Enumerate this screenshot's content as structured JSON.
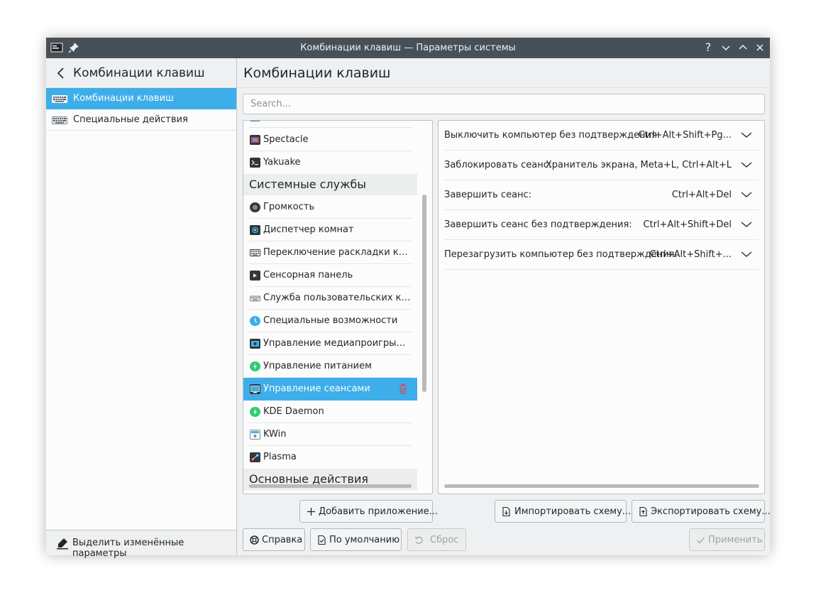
{
  "window": {
    "title": "Комбинации клавиш — Параметры системы"
  },
  "sidebar": {
    "title": "Комбинации клавиш",
    "items": [
      {
        "label": "Комбинации клавиш",
        "active": true
      },
      {
        "label": "Специальные действия",
        "active": false
      }
    ],
    "footer_label": "Выделить изменённые параметры"
  },
  "main": {
    "title": "Комбинации клавиш",
    "search": {
      "placeholder": "Search...",
      "value": ""
    }
  },
  "apps": {
    "top_items": [
      "Spectacle",
      "Yakuake"
    ],
    "section_system": "Системные службы",
    "system_items": [
      "Громкость",
      "Диспетчер комнат",
      "Переключение раскладки клавиатуры",
      "Сенсорная панель",
      "Служба пользовательских комбинаций клавиш",
      "Специальные возможности",
      "Управление медиапроигрывателем",
      "Управление питанием",
      "Управление сеансами",
      "KDE Daemon",
      "KWin",
      "Plasma"
    ],
    "selected": "Управление сеансами",
    "section_common": "Основные действия"
  },
  "shortcuts": [
    {
      "name": "Выключить компьютер без подтверждения:",
      "keys": "Ctrl+Alt+Shift+Pg..."
    },
    {
      "name": "Заблокировать сеанс:",
      "keys": "Хранитель экрана, Meta+L, Ctrl+Alt+L"
    },
    {
      "name": "Завершить сеанс:",
      "keys": "Ctrl+Alt+Del"
    },
    {
      "name": "Завершить сеанс без подтверждения:",
      "keys": "Ctrl+Alt+Shift+Del"
    },
    {
      "name": "Перезагрузить компьютер без подтверждения:",
      "keys": "Ctrl+Alt+Shift+..."
    }
  ],
  "buttons": {
    "add_app": "Добавить приложение...",
    "import": "Импортировать схему...",
    "export": "Экспортировать схему...",
    "help": "Справка",
    "defaults": "По умолчанию",
    "reset": "Сброс",
    "apply": "Применить"
  },
  "icons": {
    "app_menu": "window-menu-icon",
    "pin": "pin-icon",
    "help": "help-icon",
    "minimize": "minimize-icon",
    "maximize": "maximize-icon",
    "close": "close-icon"
  },
  "colors": {
    "accent": "#3daee9",
    "titlebar": "#475057",
    "destructive": "#da4453"
  }
}
